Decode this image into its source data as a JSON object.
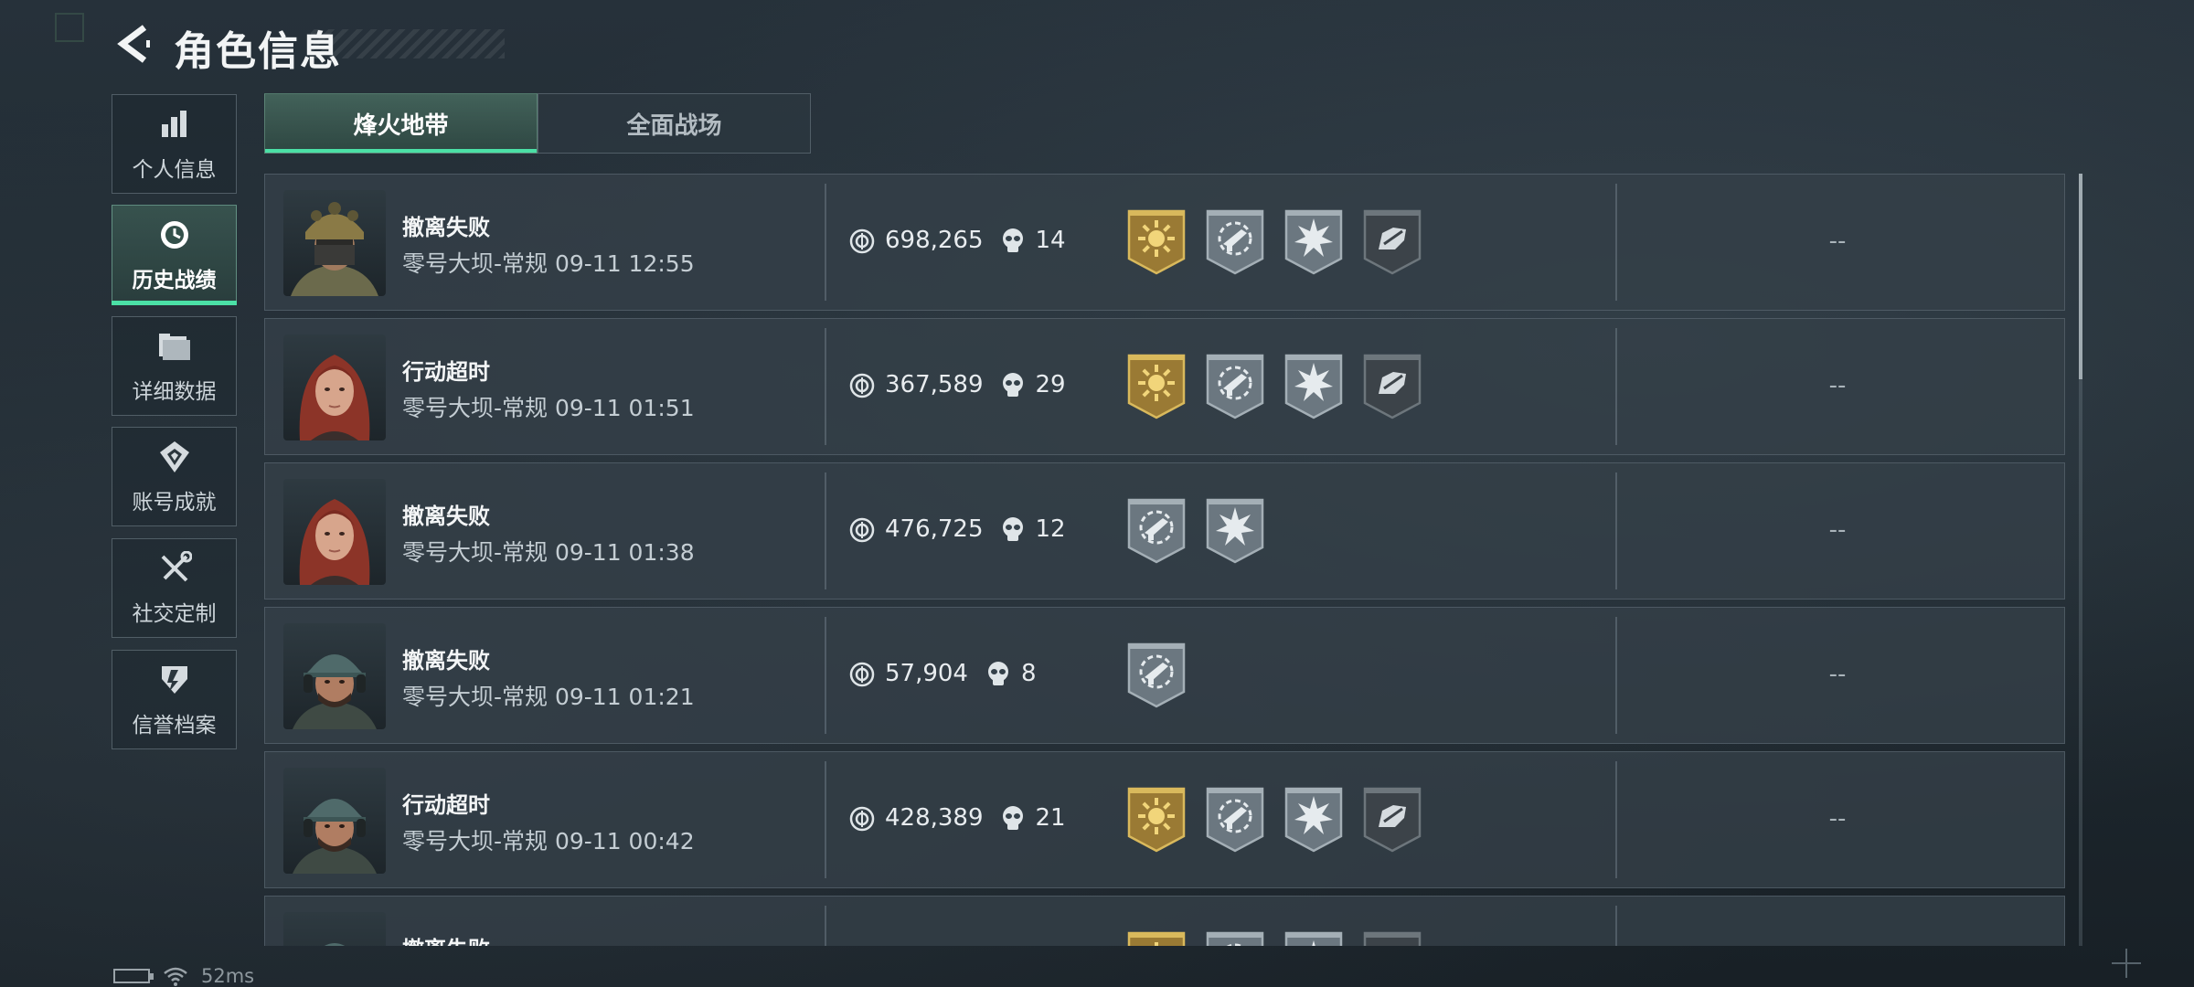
{
  "header": {
    "title": "角色信息"
  },
  "sidebar": {
    "items": [
      {
        "label": "个人信息",
        "icon": "bar-chart-icon",
        "active": false
      },
      {
        "label": "历史战绩",
        "icon": "clock-icon",
        "active": true
      },
      {
        "label": "详细数据",
        "icon": "folder-icon",
        "active": false
      },
      {
        "label": "账号成就",
        "icon": "medal-icon",
        "active": false
      },
      {
        "label": "社交定制",
        "icon": "tools-icon",
        "active": false
      },
      {
        "label": "信誉档案",
        "icon": "shield-icon",
        "active": false
      }
    ]
  },
  "tabs": [
    {
      "label": "烽火地带",
      "active": true
    },
    {
      "label": "全面战场",
      "active": false
    }
  ],
  "records": [
    {
      "status": "撤离失败",
      "detail": "零号大坝-常规 09-11 12:55",
      "value": "698,265",
      "kills": "14",
      "avatar": "armored-helmet-operator",
      "badges": [
        "gold-sun-badge",
        "gear-rifle-badge",
        "burst-badge",
        "dark-hand-badge"
      ],
      "extra": "--"
    },
    {
      "status": "行动超时",
      "detail": "零号大坝-常规 09-11 01:51",
      "value": "367,589",
      "kills": "29",
      "avatar": "red-hair-operator",
      "badges": [
        "gold-sun-badge",
        "gear-rifle-badge",
        "burst-badge",
        "dark-hand-badge"
      ],
      "extra": "--"
    },
    {
      "status": "撤离失败",
      "detail": "零号大坝-常规 09-11 01:38",
      "value": "476,725",
      "kills": "12",
      "avatar": "red-hair-operator",
      "badges": [
        "gear-rifle-badge",
        "burst-badge"
      ],
      "extra": "--"
    },
    {
      "status": "撤离失败",
      "detail": "零号大坝-常规 09-11 01:21",
      "value": "57,904",
      "kills": "8",
      "avatar": "cap-headset-operator",
      "badges": [
        "gear-rifle-badge"
      ],
      "extra": "--"
    },
    {
      "status": "行动超时",
      "detail": "零号大坝-常规 09-11 00:42",
      "value": "428,389",
      "kills": "21",
      "avatar": "cap-headset-operator",
      "badges": [
        "gold-sun-badge",
        "gear-rifle-badge",
        "burst-badge",
        "dark-hand-badge"
      ],
      "extra": "--"
    },
    {
      "status": "撤离失败",
      "detail": "",
      "value": "",
      "kills": "",
      "avatar": "cap-headset-operator",
      "badges": [
        "gold-sun-badge",
        "gear-rifle-badge",
        "burst-badge",
        "dark-hand-badge"
      ],
      "extra": ""
    }
  ],
  "status_bar": {
    "ping": "52ms"
  },
  "colors": {
    "accent": "#4be0a6",
    "gold": "#c9a64a",
    "badge_gray": "#6b7780"
  }
}
